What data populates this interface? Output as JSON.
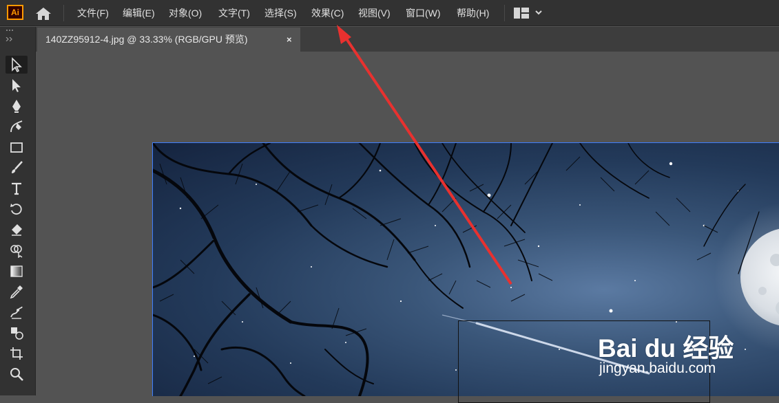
{
  "app": {
    "logo_text": "Ai",
    "accent_color": "#ff9a00"
  },
  "menubar": {
    "items": [
      {
        "label": "文件(F)"
      },
      {
        "label": "编辑(E)"
      },
      {
        "label": "对象(O)"
      },
      {
        "label": "文字(T)"
      },
      {
        "label": "选择(S)"
      },
      {
        "label": "效果(C)"
      },
      {
        "label": "视图(V)"
      },
      {
        "label": "窗口(W)"
      },
      {
        "label": "帮助(H)"
      }
    ]
  },
  "document_tab": {
    "title": "140ZZ95912-4.jpg @ 33.33% (RGB/GPU 预览)",
    "close_glyph": "×"
  },
  "tools": [
    "selection-tool",
    "direct-selection-tool",
    "pen-tool",
    "curvature-tool",
    "rectangle-tool",
    "paintbrush-tool",
    "type-tool",
    "rotate-tool",
    "eraser-tool",
    "shape-builder-tool",
    "gradient-tool",
    "eyedropper-tool",
    "puppet-warp-tool",
    "blend-tool",
    "artboard-tool",
    "zoom-tool"
  ],
  "annotation": {
    "arrow_color": "#e8312f"
  },
  "watermark": {
    "logo": "Bai du 经验",
    "url": "jingyan.baidu.com"
  }
}
